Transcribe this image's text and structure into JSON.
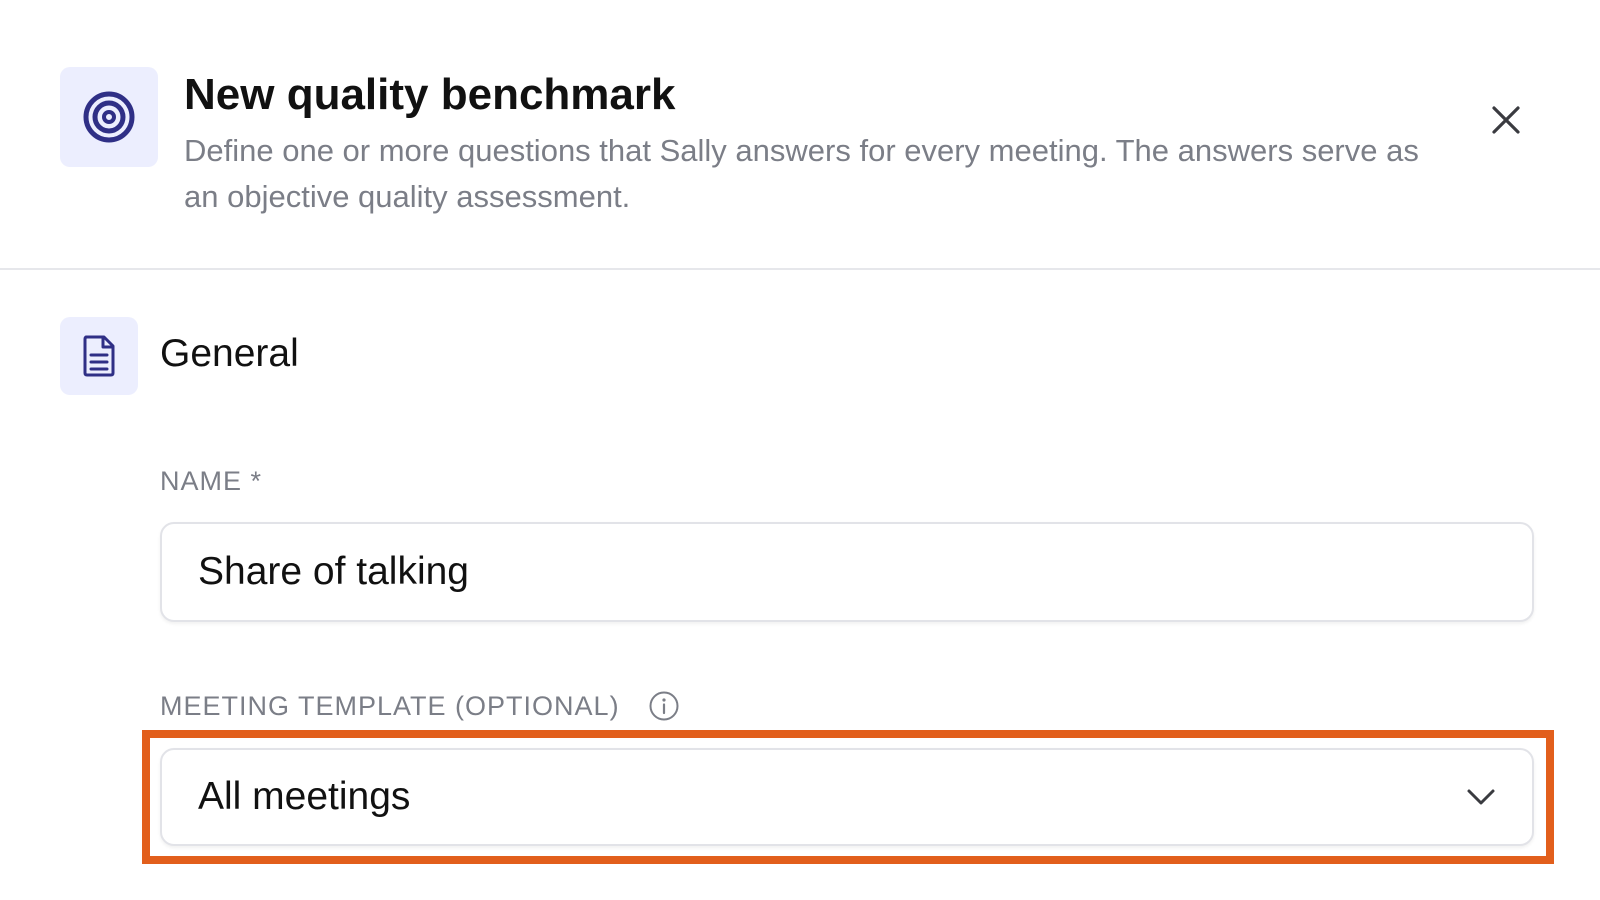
{
  "header": {
    "icon": "target-icon",
    "title": "New quality benchmark",
    "description": "Define one or more questions that Sally answers for every meeting. The answers serve as an objective quality assessment.",
    "close_icon": "close-icon"
  },
  "section": {
    "icon": "document-icon",
    "title": "General"
  },
  "form": {
    "name": {
      "label": "NAME *",
      "value": "Share of talking"
    },
    "meeting_template": {
      "label": "MEETING TEMPLATE (OPTIONAL)",
      "info_icon": "info-icon",
      "selected": "All meetings",
      "dropdown_icon": "chevron-down-icon"
    }
  },
  "colors": {
    "accent": "#3b3d8f",
    "icon_bg": "#eceefe",
    "highlight": "#e25f1c",
    "muted_text": "#7b7e87",
    "border": "#e2e3e8"
  }
}
